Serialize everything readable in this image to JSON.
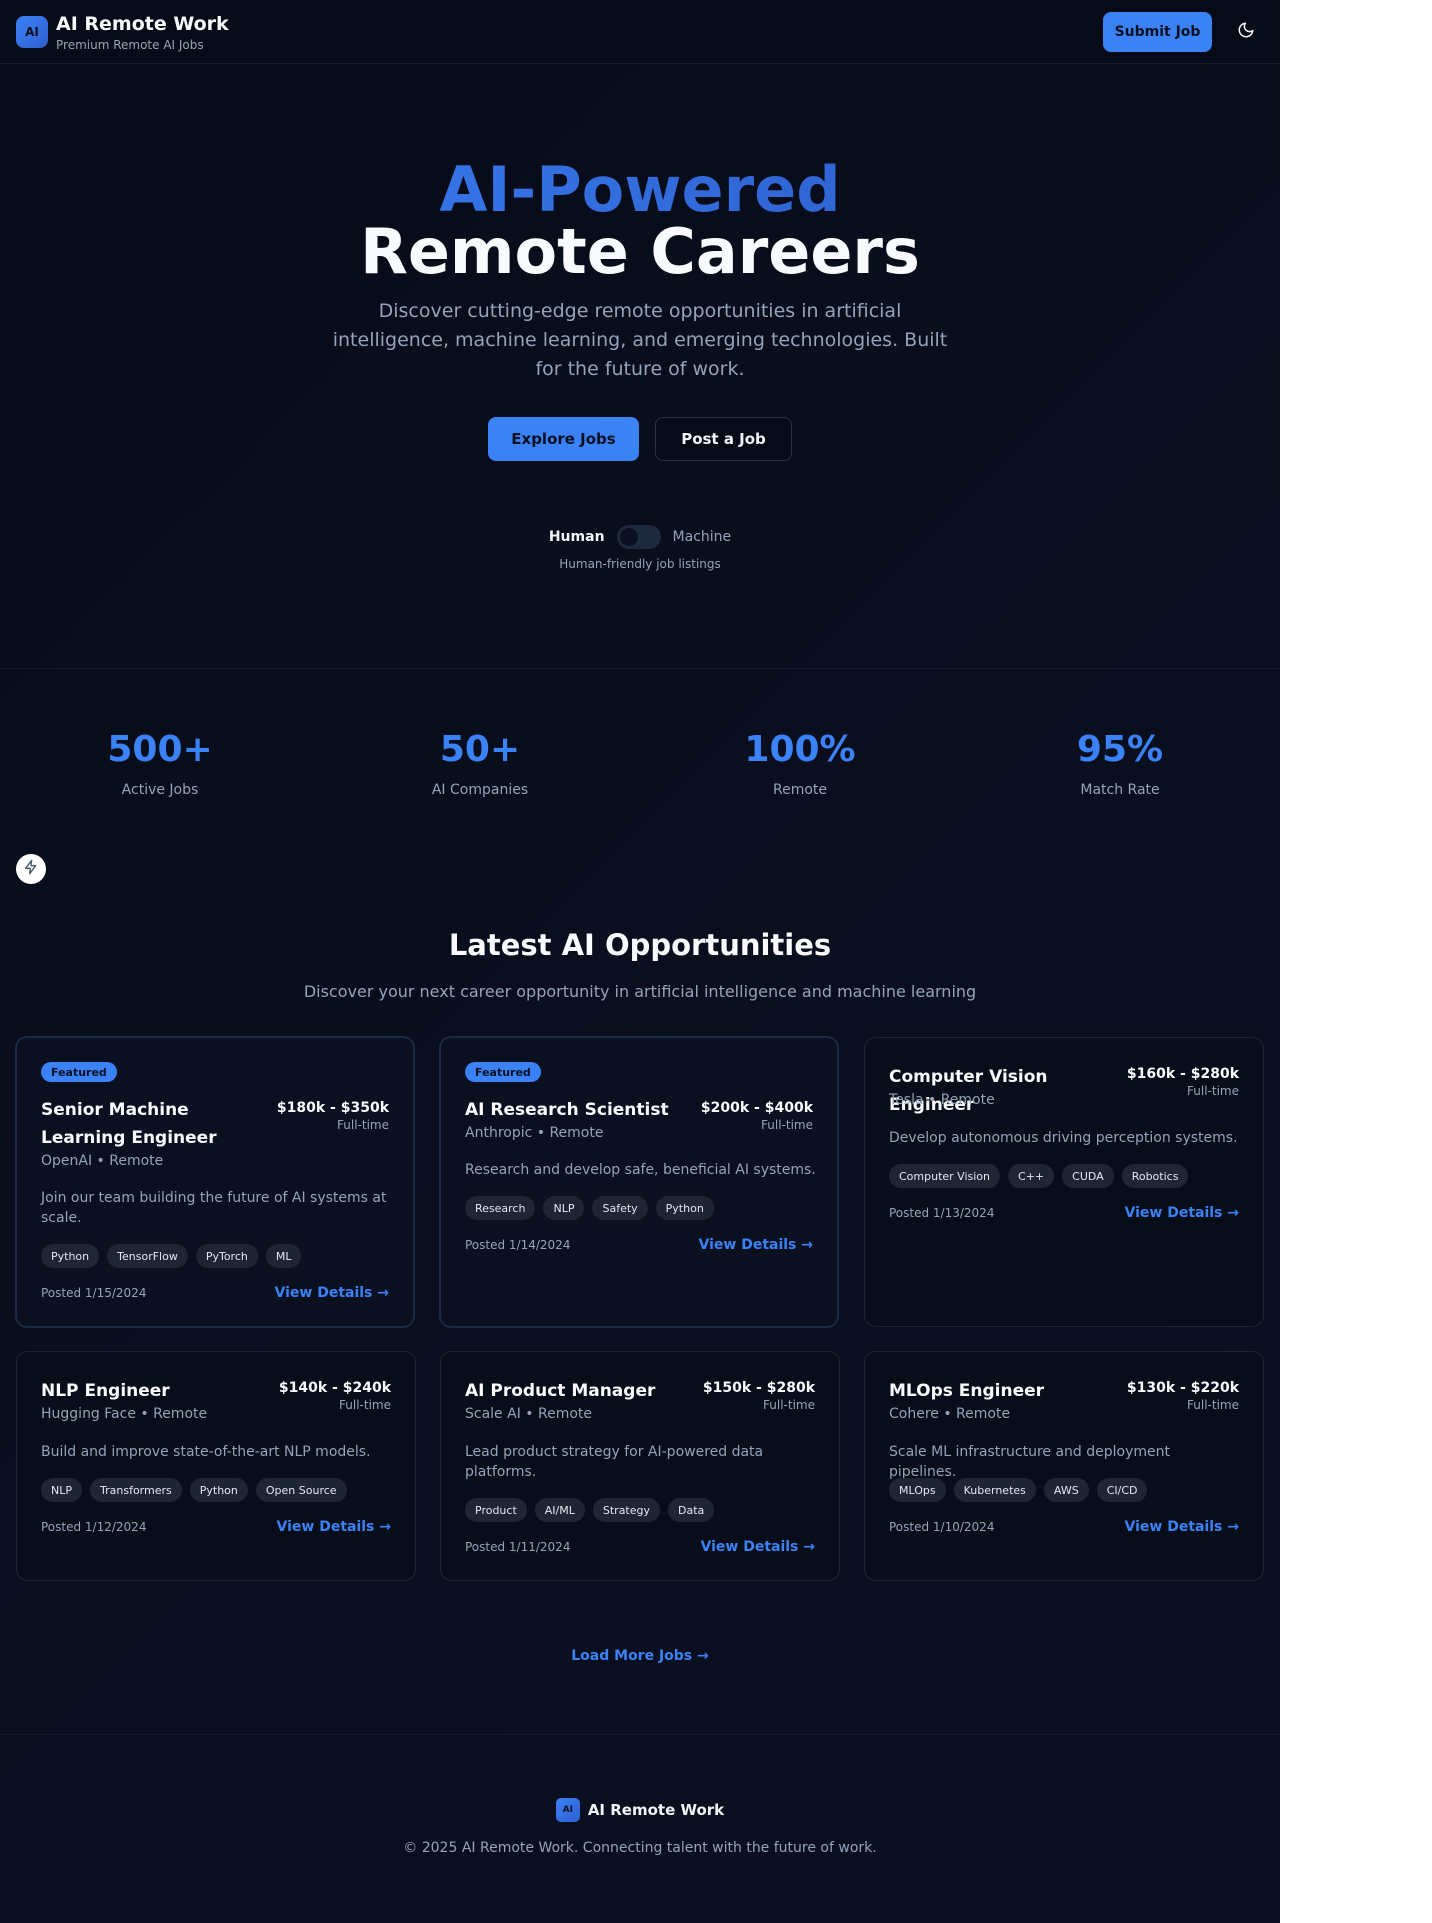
{
  "header": {
    "logo_text": "AI",
    "title": "AI Remote Work",
    "subtitle": "Premium Remote AI Jobs",
    "submit_label": "Submit Job",
    "theme_icon": "moon-icon"
  },
  "hero": {
    "line1": "AI-Powered",
    "line2": "Remote Careers",
    "description": "Discover cutting-edge remote opportunities in artificial intelligence, machine learning, and emerging technologies. Built for the future of work.",
    "explore_label": "Explore Jobs",
    "post_label": "Post a Job",
    "toggle": {
      "left_label": "Human",
      "right_label": "Machine",
      "hint": "Human-friendly job listings",
      "state": "Human"
    }
  },
  "stats": [
    {
      "value": "500+",
      "label": "Active Jobs"
    },
    {
      "value": "50+",
      "label": "AI Companies"
    },
    {
      "value": "100%",
      "label": "Remote"
    },
    {
      "value": "95%",
      "label": "Match Rate"
    }
  ],
  "floating_icon": "lightning-icon",
  "jobs_section": {
    "title": "Latest AI Opportunities",
    "subtitle": "Discover your next career opportunity in artificial intelligence and machine learning",
    "details_label": "View Details →",
    "load_more_label": "Load More Jobs →",
    "jobs": [
      {
        "featured": true,
        "badge": "Featured",
        "title": "Senior Machine Learning Engineer",
        "company": "OpenAI • Remote",
        "salary": "$180k - $350k",
        "type": "Full-time",
        "description": "Join our team building the future of AI systems at scale.",
        "tags": [
          "Python",
          "TensorFlow",
          "PyTorch",
          "ML"
        ],
        "posted": "Posted 1/15/2024"
      },
      {
        "featured": true,
        "badge": "Featured",
        "title": "AI Research Scientist",
        "company": "Anthropic • Remote",
        "salary": "$200k - $400k",
        "type": "Full-time",
        "description": "Research and develop safe, beneficial AI systems.",
        "tags": [
          "Research",
          "NLP",
          "Safety",
          "Python"
        ],
        "posted": "Posted 1/14/2024"
      },
      {
        "featured": false,
        "title": "Computer Vision Engineer",
        "company": "Tesla • Remote",
        "salary": "$160k - $280k",
        "type": "Full-time",
        "description": "Develop autonomous driving perception systems.",
        "tags": [
          "Computer Vision",
          "C++",
          "CUDA",
          "Robotics"
        ],
        "posted": "Posted 1/13/2024"
      },
      {
        "featured": false,
        "title": "NLP Engineer",
        "company": "Hugging Face • Remote",
        "salary": "$140k - $240k",
        "type": "Full-time",
        "description": "Build and improve state-of-the-art NLP models.",
        "tags": [
          "NLP",
          "Transformers",
          "Python",
          "Open Source"
        ],
        "posted": "Posted 1/12/2024"
      },
      {
        "featured": false,
        "title": "AI Product Manager",
        "company": "Scale AI • Remote",
        "salary": "$150k - $280k",
        "type": "Full-time",
        "description": "Lead product strategy for AI-powered data platforms.",
        "tags": [
          "Product",
          "AI/ML",
          "Strategy",
          "Data"
        ],
        "posted": "Posted 1/11/2024"
      },
      {
        "featured": false,
        "title": "MLOps Engineer",
        "company": "Cohere • Remote",
        "salary": "$130k - $220k",
        "type": "Full-time",
        "description": "Scale ML infrastructure and deployment pipelines.",
        "tags": [
          "MLOps",
          "Kubernetes",
          "AWS",
          "CI/CD"
        ],
        "posted": "Posted 1/10/2024"
      }
    ]
  },
  "footer": {
    "logo_text": "AI",
    "name": "AI Remote Work",
    "copyright": "© 2025 AI Remote Work. Connecting talent with the future of work."
  },
  "colors": {
    "background": "#080c19",
    "accent": "#3b82f6",
    "muted_text": "#94a3b8",
    "tag_bg": "#1e2533"
  }
}
